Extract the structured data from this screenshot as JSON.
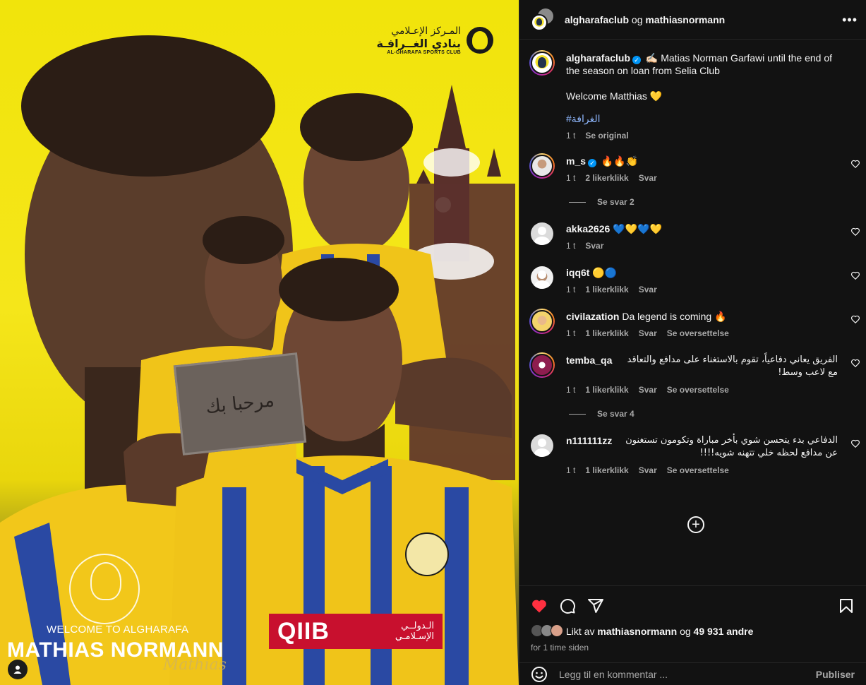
{
  "poster": {
    "club_ar_line1": "المـركز الإعـلامي",
    "club_ar_line2": "بنادي الغــرافـة",
    "club_en": "AL-GHARAFA SPORTS CLUB",
    "welcome": "WELCOME TO ALGHARAFA",
    "player_name": "MATHIAS NORMANN",
    "signature": "Mathias",
    "sign_text": "مرحبا بك",
    "sponsor": "QIIB",
    "sponsor_ar_1": "الـدولــي",
    "sponsor_ar_2": "الإسـلامـي"
  },
  "header": {
    "account": "algharafaclub",
    "joiner": "og",
    "collaborator": "mathiasnormann"
  },
  "caption": {
    "username": "algharafaclub",
    "text_1": "✍🏻 Matias Norman Garfawi until the end of the season on loan from Selia Club",
    "text_2": "Welcome Matthias 💛",
    "hashtag": "#الغرافة",
    "time": "1 t",
    "see_original": "Se original"
  },
  "comments": [
    {
      "username": "m_s",
      "verified": true,
      "text": "🔥🔥👏",
      "time": "1 t",
      "likes": "2 likerklikk",
      "reply": "Svar",
      "translate": "",
      "rtl": false
    },
    {
      "username": "akka2626",
      "verified": false,
      "text": "💙💛💙💛",
      "time": "1 t",
      "likes": "",
      "reply": "Svar",
      "translate": "",
      "rtl": false
    },
    {
      "username": "iqq6t",
      "verified": false,
      "text": "🟡🔵",
      "time": "1 t",
      "likes": "1 likerklikk",
      "reply": "Svar",
      "translate": "",
      "rtl": false
    },
    {
      "username": "civilazation",
      "verified": false,
      "text": "Da legend is coming 🔥",
      "time": "1 t",
      "likes": "1 likerklikk",
      "reply": "Svar",
      "translate": "Se oversettelse",
      "rtl": false
    },
    {
      "username": "temba_qa",
      "verified": false,
      "text": "الفريق يعاني دفاعياً، تقوم بالاستغناء على مدافع والتعاقد مع لاعب وسط!",
      "time": "1 t",
      "likes": "1 likerklikk",
      "reply": "Svar",
      "translate": "Se oversettelse",
      "rtl": true
    },
    {
      "username": "n111111zz",
      "verified": false,
      "text": "الدفاعي بدء يتحسن شوي بأخر مباراة وتكومون تستغنون عن مدافع لحظه خلي تتهنه شويه!!!!",
      "time": "1 t",
      "likes": "1 likerklikk",
      "reply": "Svar",
      "translate": "Se oversettelse",
      "rtl": true
    }
  ],
  "replies": [
    {
      "label": "Se svar 2"
    },
    {
      "label": "Se svar 4"
    }
  ],
  "actions": {
    "liked_by_prefix": "Likt av",
    "liked_by_user": "mathiasnormann",
    "liked_by_joiner": "og",
    "liked_by_count": "49 931 andre",
    "time_ago": "for 1 time siden"
  },
  "composer": {
    "placeholder": "Legg til en kommentar ...",
    "publish": "Publiser"
  },
  "colors": {
    "like_red": "#ff3040",
    "link_blue": "#8fb8ff",
    "verified_blue": "#0095f6",
    "poster_yellow": "#f1e40b"
  }
}
